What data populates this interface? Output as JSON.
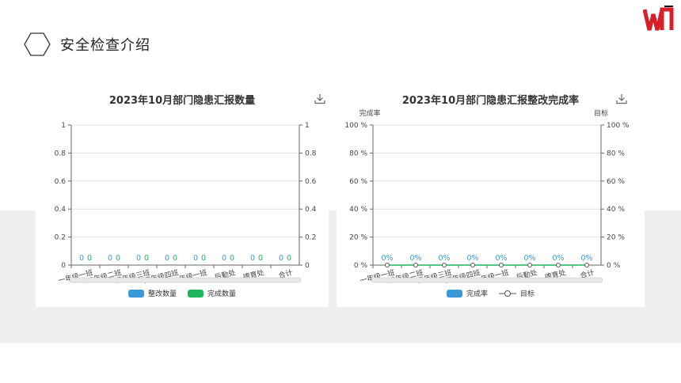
{
  "page": {
    "title": "安全检查介绍"
  },
  "colors": {
    "blue": "#3a98d8",
    "green": "#1db65c",
    "logo_red": "#d81e2a",
    "axis": "#666666",
    "grid": "#e3e3e3"
  },
  "chart_data": [
    {
      "type": "bar",
      "title": "2023年10月部门隐患汇报数量",
      "categories": [
        "一年级一班",
        "二年级二班",
        "三年级三班",
        "四年级四班",
        "一年级一班",
        "后勤处",
        "德育处",
        "合计"
      ],
      "series": [
        {
          "name": "整改数量",
          "values": [
            0,
            0,
            0,
            0,
            0,
            0,
            0,
            0
          ],
          "labels": [
            "0",
            "0",
            "0",
            "0",
            "0",
            "0",
            "0",
            "0"
          ]
        },
        {
          "name": "完成数量",
          "values": [
            0,
            0,
            0,
            0,
            0,
            0,
            0,
            0
          ],
          "labels": [
            "0",
            "0",
            "0",
            "0",
            "0",
            "0",
            "0",
            "0"
          ]
        }
      ],
      "ylim": [
        0,
        1
      ],
      "yticks": [
        "0",
        "0.2",
        "0.4",
        "0.6",
        "0.8",
        "1"
      ],
      "y2ticks": [
        "0",
        "0.2",
        "0.4",
        "0.6",
        "0.8",
        "1"
      ],
      "legend": "bottom",
      "grid": true
    },
    {
      "type": "bar",
      "title": "2023年10月部门隐患汇报整改完成率",
      "ylabel": "完成率",
      "y2label": "目标",
      "categories": [
        "一年级一班",
        "二年级二班",
        "三年级三班",
        "四年级四班",
        "一年级一班",
        "后勤处",
        "德育处",
        "合计"
      ],
      "series": [
        {
          "name": "完成率",
          "values": [
            0,
            0,
            0,
            0,
            0,
            0,
            0,
            0
          ],
          "labels": [
            "0%",
            "0%",
            "0%",
            "0%",
            "0%",
            "0%",
            "0%",
            "0%"
          ]
        },
        {
          "name": "目标",
          "type": "line",
          "values": [
            0,
            0,
            0,
            0,
            0,
            0,
            0,
            0
          ]
        }
      ],
      "ylim": [
        0,
        100
      ],
      "yticks": [
        "0 %",
        "20 %",
        "40 %",
        "60 %",
        "80 %",
        "100 %"
      ],
      "y2ticks": [
        "0 %",
        "20 %",
        "40 %",
        "60 %",
        "80 %",
        "100 %"
      ],
      "legend": "bottom",
      "grid": true
    }
  ]
}
